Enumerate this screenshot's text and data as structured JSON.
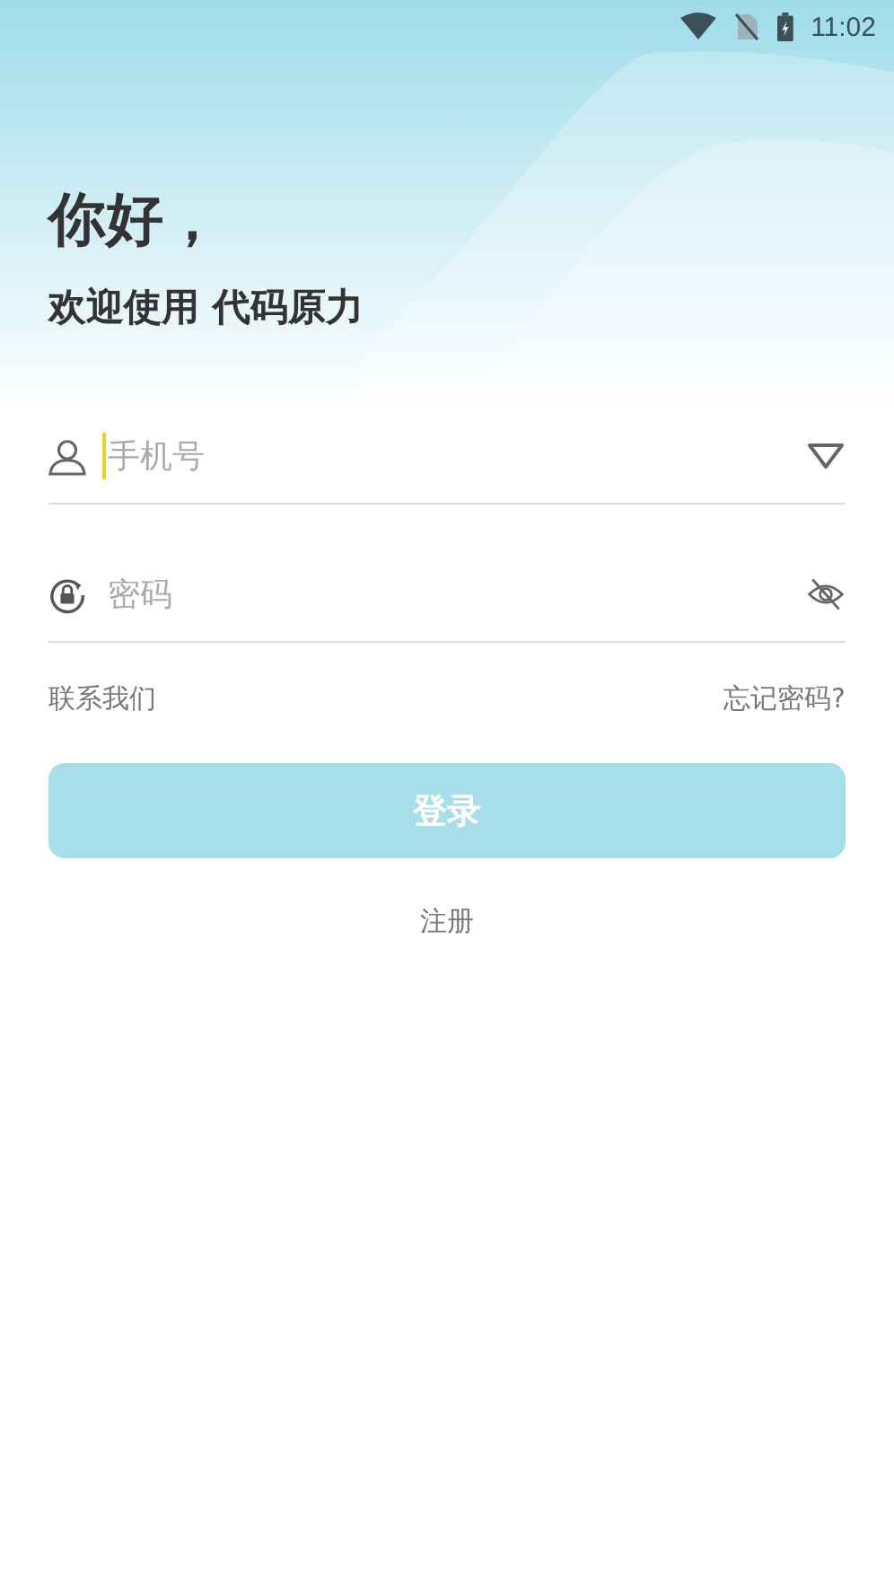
{
  "status_bar": {
    "time": "11:02"
  },
  "greeting": "你好，",
  "welcome": "欢迎使用 代码原力",
  "phone_field": {
    "placeholder": "手机号",
    "focused": true
  },
  "password_field": {
    "placeholder": "密码"
  },
  "contact_link": "联系我们",
  "forgot_link": "忘记密码?",
  "login_button": {
    "label": "登录",
    "disabled": true
  },
  "register_link": "注册"
}
